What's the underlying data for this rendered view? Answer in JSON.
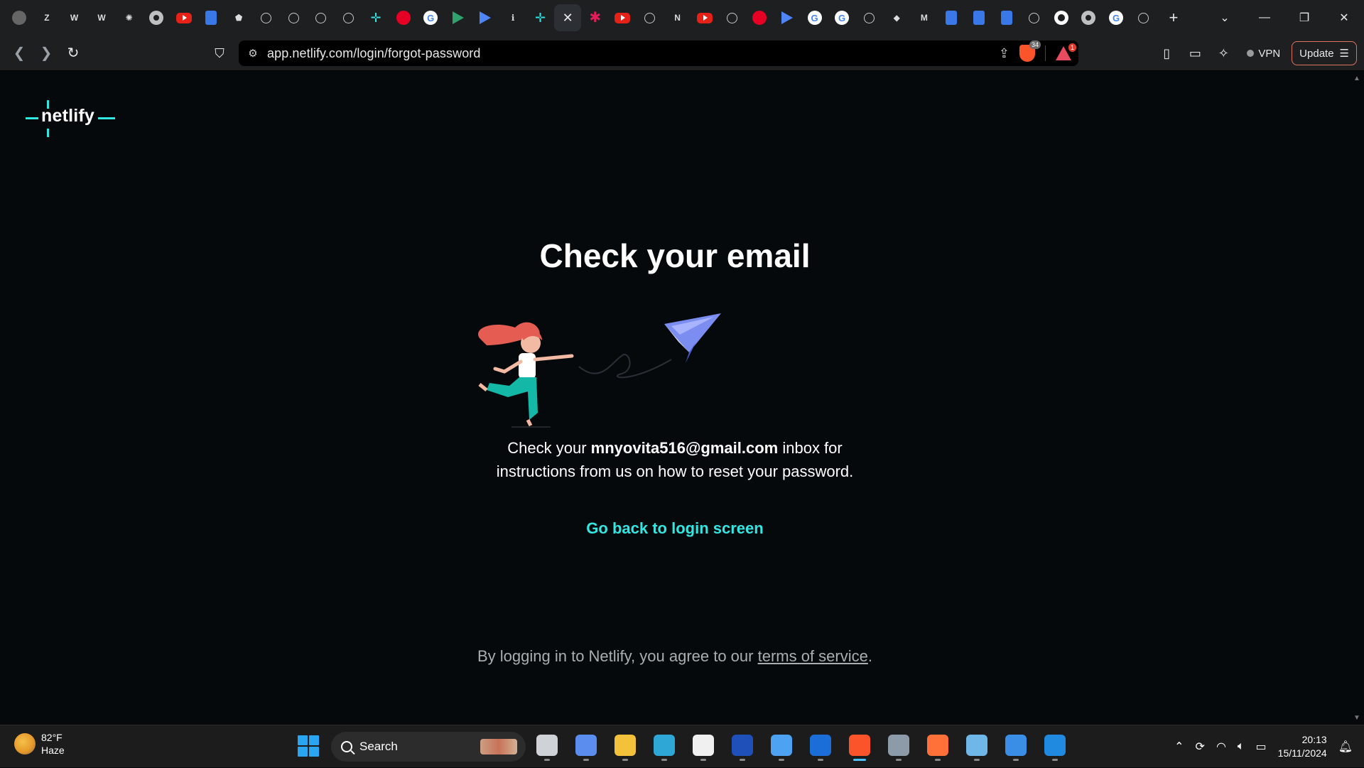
{
  "browser": {
    "tabs": [
      {
        "icon": "circle-icon",
        "kind": "dot"
      },
      {
        "icon": "zb-icon",
        "kind": "text",
        "text": "Z"
      },
      {
        "icon": "w-icon",
        "kind": "text",
        "text": "W"
      },
      {
        "icon": "wp-icon",
        "kind": "text",
        "text": "W"
      },
      {
        "icon": "asterisk-icon",
        "kind": "text",
        "text": "✺"
      },
      {
        "icon": "globe-icon",
        "kind": "globe"
      },
      {
        "icon": "youtube-icon",
        "kind": "yt"
      },
      {
        "icon": "list-icon",
        "kind": "doc"
      },
      {
        "icon": "shield-icon",
        "kind": "text",
        "text": "⬟"
      },
      {
        "icon": "openai-icon",
        "kind": "gpt"
      },
      {
        "icon": "openai-icon",
        "kind": "gpt"
      },
      {
        "icon": "openai-icon",
        "kind": "gpt"
      },
      {
        "icon": "openai-icon",
        "kind": "gpt"
      },
      {
        "icon": "netlify-icon",
        "kind": "netl",
        "text": "✛"
      },
      {
        "icon": "pinterest-icon",
        "kind": "pin"
      },
      {
        "icon": "google-icon",
        "kind": "google",
        "text": "G"
      },
      {
        "icon": "play-icon",
        "kind": "play"
      },
      {
        "icon": "play-icon",
        "kind": "play b"
      },
      {
        "icon": "info-icon",
        "kind": "text",
        "text": "ℹ"
      },
      {
        "icon": "netlify-icon",
        "kind": "netl",
        "text": "✛"
      },
      {
        "icon": "close-icon",
        "kind": "close",
        "active": true
      },
      {
        "icon": "slack-icon",
        "kind": "slack",
        "text": "✱"
      },
      {
        "icon": "youtube-icon",
        "kind": "yt"
      },
      {
        "icon": "openai-icon",
        "kind": "gpt"
      },
      {
        "icon": "notion-icon",
        "kind": "text",
        "text": "N"
      },
      {
        "icon": "youtube-icon",
        "kind": "yt"
      },
      {
        "icon": "openai-icon",
        "kind": "gpt"
      },
      {
        "icon": "pinterest-icon",
        "kind": "pin"
      },
      {
        "icon": "play-icon",
        "kind": "play b"
      },
      {
        "icon": "google-icon",
        "kind": "google",
        "text": "G"
      },
      {
        "icon": "google-icon",
        "kind": "google",
        "text": "G"
      },
      {
        "icon": "openai-icon",
        "kind": "gpt"
      },
      {
        "icon": "diamond-icon",
        "kind": "text",
        "text": "◆"
      },
      {
        "icon": "gmail-icon",
        "kind": "text",
        "text": "M"
      },
      {
        "icon": "docs-icon",
        "kind": "doc"
      },
      {
        "icon": "docs-icon",
        "kind": "doc"
      },
      {
        "icon": "chart-icon",
        "kind": "doc"
      },
      {
        "icon": "openai-icon",
        "kind": "gpt"
      },
      {
        "icon": "github-icon",
        "kind": "gh"
      },
      {
        "icon": "globe-icon",
        "kind": "globe"
      },
      {
        "icon": "google-icon",
        "kind": "google",
        "text": "G"
      },
      {
        "icon": "openai-icon",
        "kind": "gpt"
      }
    ],
    "url": "app.netlify.com/login/forgot-password",
    "brave_shield_count": "34",
    "rewards_count": "1",
    "vpn_label": "VPN",
    "update_label": "Update"
  },
  "page": {
    "logo_text": "netlify",
    "heading": "Check your email",
    "message_prefix": "Check your",
    "email": "mnyovita516@gmail.com",
    "message_suffix_1": "inbox for",
    "message_line_2": "instructions from us on how to reset your password.",
    "back_link": "Go back to login screen",
    "terms_prefix": "By logging in to Netlify, you agree to our",
    "terms_link": "terms of service",
    "terms_suffix": "."
  },
  "taskbar": {
    "weather_temp": "82°F",
    "weather_desc": "Haze",
    "search_label": "Search",
    "time": "20:13",
    "date": "15/11/2024",
    "apps": [
      {
        "name": "task-view-icon",
        "color": "#cfd3d8"
      },
      {
        "name": "copilot-icon",
        "color": "#5b8def"
      },
      {
        "name": "file-explorer-icon",
        "color": "#f3c13a"
      },
      {
        "name": "edge-icon",
        "color": "#2fa7d6"
      },
      {
        "name": "store-icon",
        "color": "#f0f0f0"
      },
      {
        "name": "l-app-icon",
        "color": "#1f4fb8"
      },
      {
        "name": "app-icon",
        "color": "#4da3f2"
      },
      {
        "name": "outlook-icon",
        "color": "#1b6ed8"
      },
      {
        "name": "brave-icon",
        "color": "#fb542b",
        "active": true
      },
      {
        "name": "settings-icon",
        "color": "#8d9aa8"
      },
      {
        "name": "firefox-icon",
        "color": "#ff7139"
      },
      {
        "name": "notepad-icon",
        "color": "#6fb7e8"
      },
      {
        "name": "paint-icon",
        "color": "#3a8ee6"
      },
      {
        "name": "vscode-icon",
        "color": "#1f8ae0"
      }
    ]
  },
  "colors": {
    "accent": "#32e6e2",
    "page_bg": "#06090c",
    "terms_text": "#a9aeb3"
  }
}
